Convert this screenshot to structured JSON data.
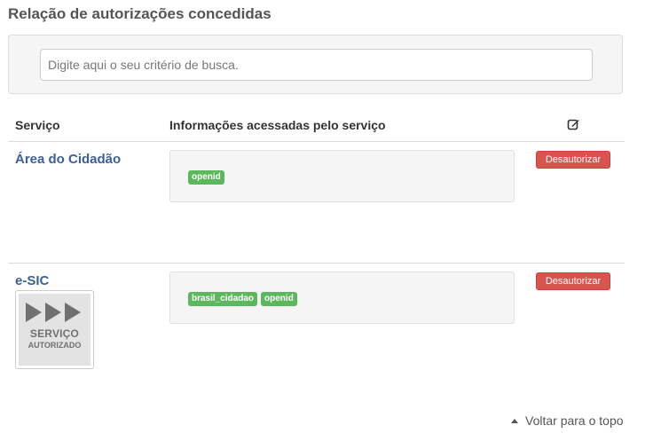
{
  "page": {
    "title": "Relação de autorizações concedidas"
  },
  "search": {
    "placeholder": "Digite aqui o seu critério de busca."
  },
  "table": {
    "columns": {
      "service": "Serviço",
      "info": "Informações acessadas pelo serviço",
      "action_icon": "edit-icon"
    },
    "rows": [
      {
        "service": "Área do Cidadão",
        "scopes": [
          "openid"
        ],
        "action": "Desautorizar"
      },
      {
        "service": "e-SIC",
        "scopes": [
          "brasil_cidadao",
          "openid"
        ],
        "action": "Desautorizar",
        "logo": {
          "line1": "SERVIÇO",
          "line2": "AUTORIZADO",
          "icon": "play-arrows-icon"
        }
      }
    ]
  },
  "footer": {
    "back_to_top": "Voltar para o topo"
  },
  "colors": {
    "link": "#3a5f99",
    "badge": "#5cb85c",
    "danger": "#d9534f",
    "panel": "#f5f5f5"
  }
}
